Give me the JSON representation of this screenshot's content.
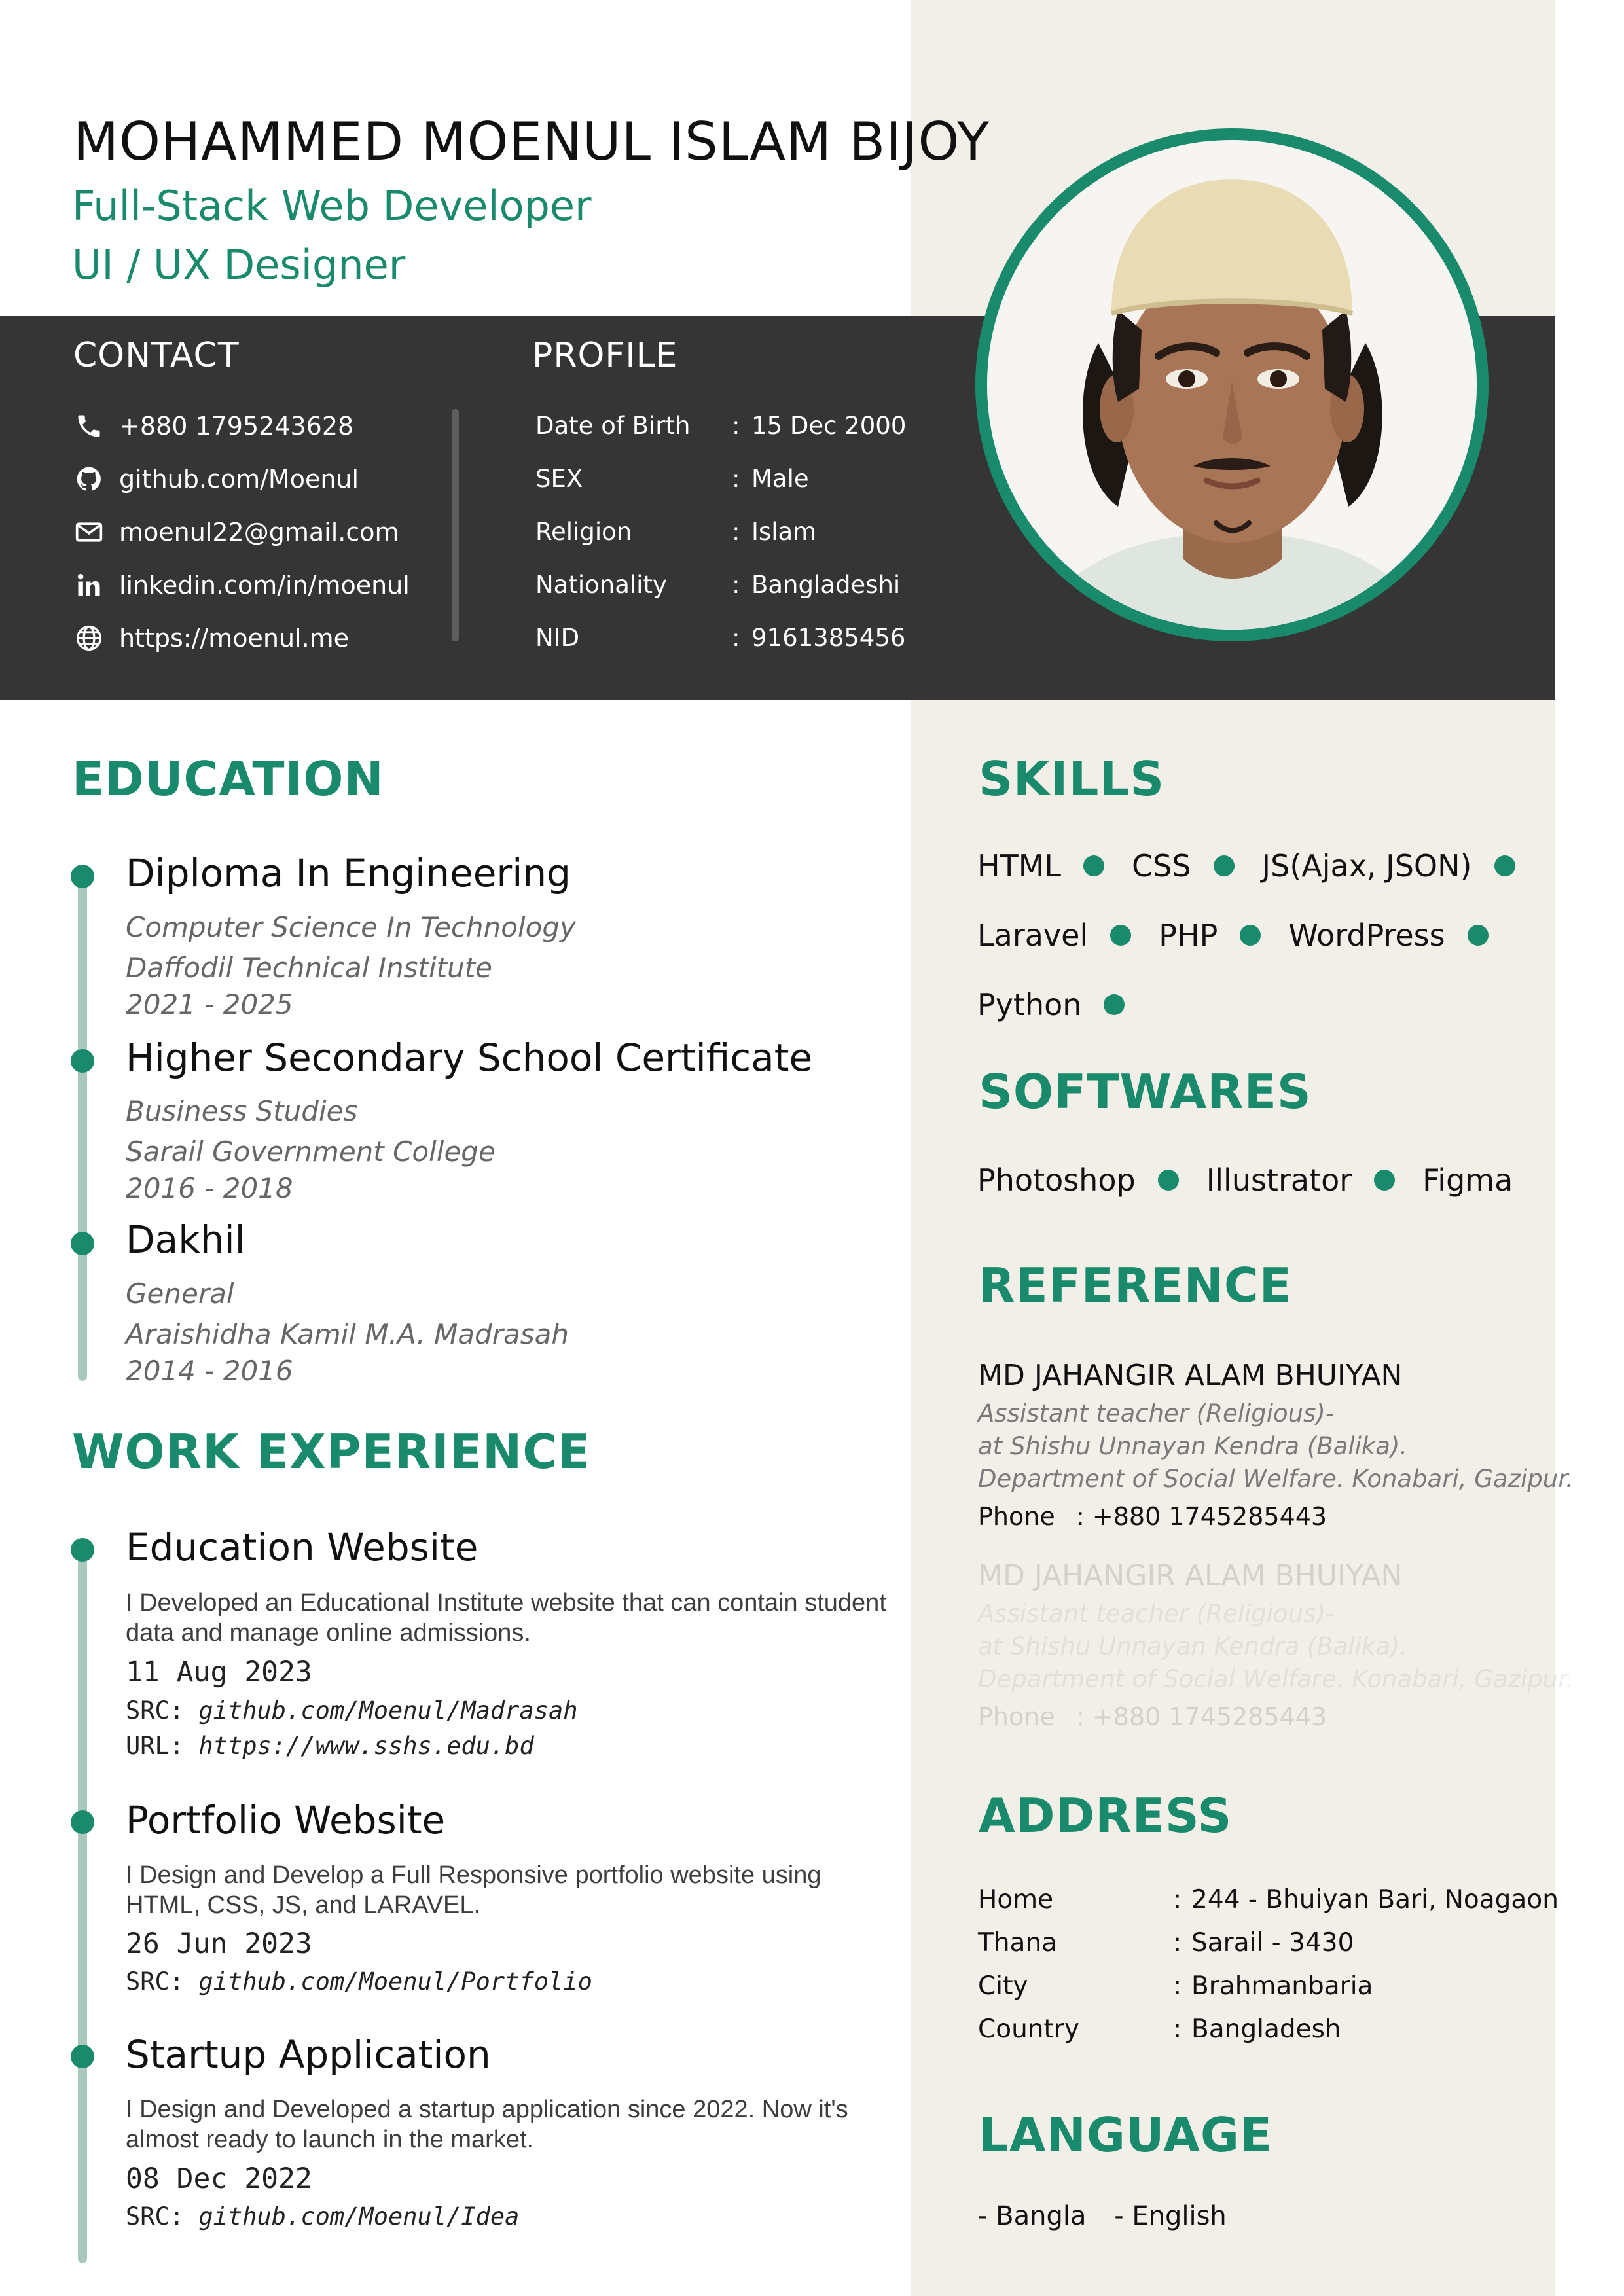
{
  "header": {
    "name": "MOHAMMED MOENUL ISLAM BIJOY",
    "titles": [
      "Full-Stack Web Developer",
      "UI / UX Designer"
    ]
  },
  "contact": {
    "heading": "CONTACT",
    "items": [
      {
        "icon": "phone-icon",
        "text": "+880 1795243628"
      },
      {
        "icon": "github-icon",
        "text": "github.com/Moenul"
      },
      {
        "icon": "mail-icon",
        "text": "moenul22@gmail.com"
      },
      {
        "icon": "linkedin-icon",
        "text": "linkedin.com/in/moenul"
      },
      {
        "icon": "globe-icon",
        "text": "https://moenul.me"
      }
    ]
  },
  "profile": {
    "heading": "PROFILE",
    "rows": [
      {
        "label": "Date of Birth",
        "value": "15 Dec 2000"
      },
      {
        "label": "SEX",
        "value": "Male"
      },
      {
        "label": "Religion",
        "value": "Islam"
      },
      {
        "label": "Nationality",
        "value": "Bangladeshi"
      },
      {
        "label": "NID",
        "value": "9161385456"
      }
    ]
  },
  "education": {
    "heading": "EDUCATION",
    "entries": [
      {
        "title": "Diploma In Engineering",
        "field": "Computer Science In Technology",
        "institute": "Daffodil Technical Institute",
        "years": "2021 - 2025"
      },
      {
        "title": "Higher Secondary School Certificate",
        "field": "Business Studies",
        "institute": "Sarail Government College",
        "years": "2016 - 2018"
      },
      {
        "title": "Dakhil",
        "field": "General",
        "institute": "Araishidha Kamil M.A. Madrasah",
        "years": "2014 - 2016"
      }
    ]
  },
  "work": {
    "heading": "WORK EXPERIENCE",
    "entries": [
      {
        "title": "Education Website",
        "desc": "I Developed an Educational Institute website that can contain student data and manage online admissions.",
        "date": "11 Aug 2023",
        "src_label": "SRC:",
        "src": "github.com/Moenul/Madrasah",
        "url_label": "URL:",
        "url": "https://www.sshs.edu.bd"
      },
      {
        "title": "Portfolio Website",
        "desc": "I Design and Develop a Full Responsive portfolio website using HTML, CSS, JS, and LARAVEL.",
        "date": "26 Jun 2023",
        "src_label": "SRC:",
        "src": "github.com/Moenul/Portfolio"
      },
      {
        "title": "Startup Application",
        "desc": "I Design and Developed a startup application since 2022. Now it's almost ready to launch in the market.",
        "date": "08 Dec 2022",
        "src_label": "SRC:",
        "src": "github.com/Moenul/Idea"
      }
    ]
  },
  "skills": {
    "heading": "SKILLS",
    "rows": [
      [
        "HTML",
        "CSS",
        "JS(Ajax, JSON)"
      ],
      [
        "Laravel",
        "PHP",
        "WordPress"
      ],
      [
        "Python"
      ]
    ]
  },
  "softwares": {
    "heading": "SOFTWARES",
    "items": [
      "Photoshop",
      "Illustrator",
      "Figma"
    ]
  },
  "reference": {
    "heading": "REFERENCE",
    "entries": [
      {
        "name": "MD JAHANGIR ALAM BHUIYAN",
        "lines": [
          "Assistant teacher (Religious)-",
          "at Shishu Unnayan Kendra (Balika).",
          "Department of Social Welfare. Konabari, Gazipur."
        ],
        "phone_label": "Phone",
        "phone": ": +880 1745285443"
      },
      {
        "name": "MD JAHANGIR ALAM BHUIYAN",
        "lines": [
          "Assistant teacher (Religious)-",
          "at Shishu Unnayan Kendra (Balika).",
          "Department of Social Welfare. Konabari, Gazipur."
        ],
        "phone_label": "Phone",
        "phone": ": +880 1745285443"
      }
    ]
  },
  "address": {
    "heading": "ADDRESS",
    "rows": [
      {
        "label": "Home",
        "value": "244 - Bhuiyan Bari, Noagaon"
      },
      {
        "label": "Thana",
        "value": "Sarail - 3430"
      },
      {
        "label": "City",
        "value": "Brahmanbaria"
      },
      {
        "label": "Country",
        "value": "Bangladesh"
      }
    ]
  },
  "language": {
    "heading": "LANGUAGE",
    "items": [
      "- Bangla",
      "- English"
    ]
  },
  "colors": {
    "accent": "#1a8a6c",
    "band": "#353535",
    "sidebar": "#f2eee8",
    "timeline": "#a9c9bd"
  }
}
